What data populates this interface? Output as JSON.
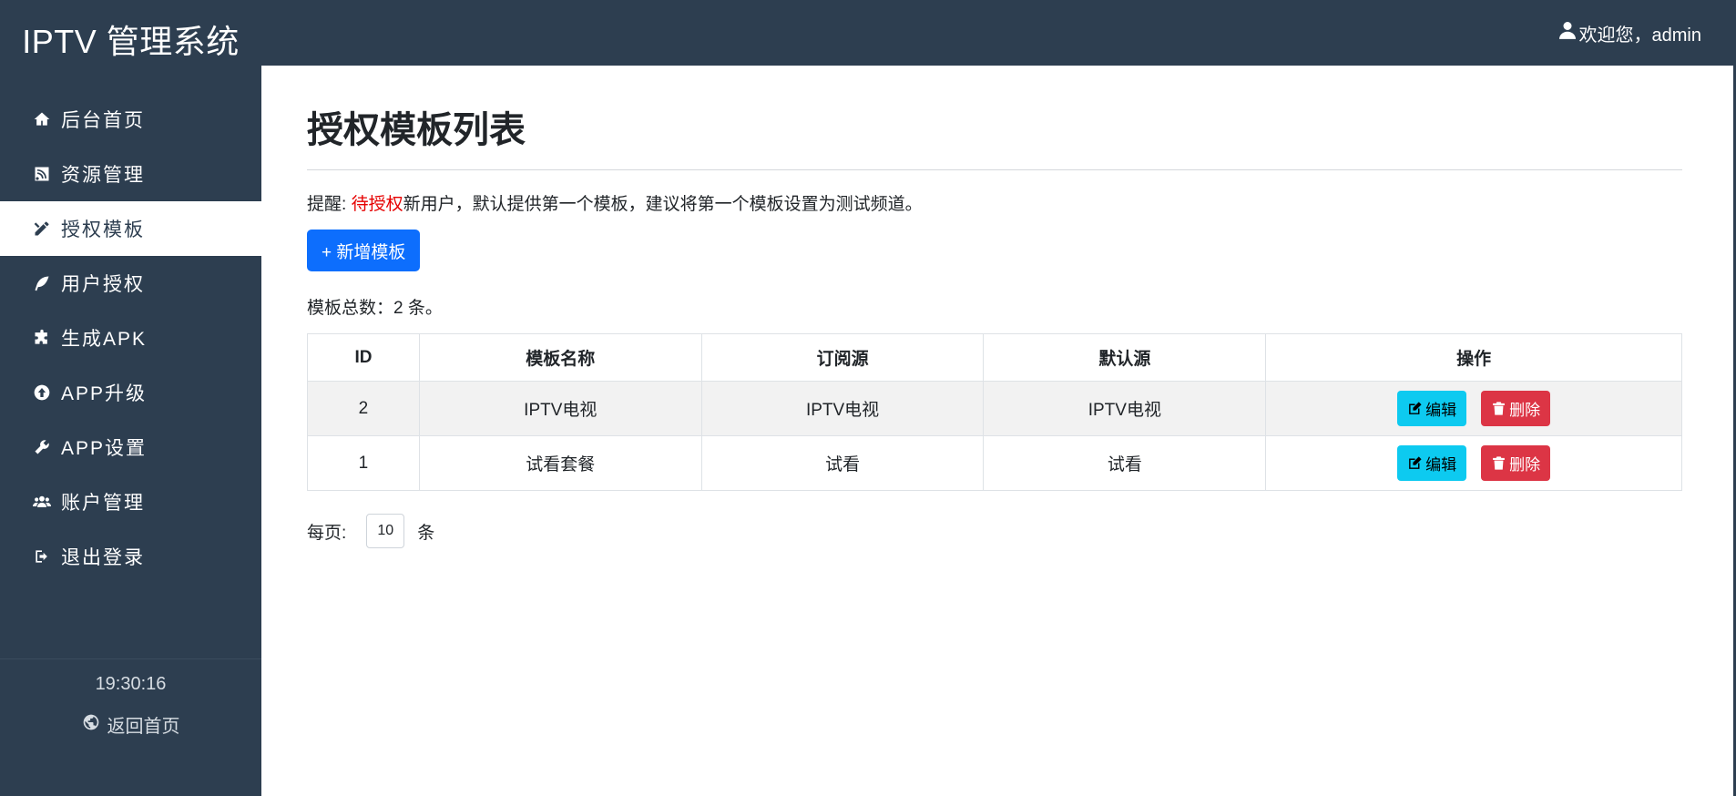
{
  "sidebar": {
    "brand": "IPTV 管理系统",
    "items": [
      {
        "label": "后台首页",
        "icon": "home-icon"
      },
      {
        "label": "资源管理",
        "icon": "rss-icon"
      },
      {
        "label": "授权模板",
        "icon": "tools-icon",
        "active": true
      },
      {
        "label": "用户授权",
        "icon": "feather-icon"
      },
      {
        "label": "生成APK",
        "icon": "puzzle-icon"
      },
      {
        "label": "APP升级",
        "icon": "upload-circle-icon"
      },
      {
        "label": "APP设置",
        "icon": "wrench-icon"
      },
      {
        "label": "账户管理",
        "icon": "users-icon"
      },
      {
        "label": "退出登录",
        "icon": "sign-out-icon"
      }
    ],
    "clock": "19:30:16",
    "back_home": "返回首页"
  },
  "header": {
    "user_greeting": "欢迎您，admin"
  },
  "main": {
    "title": "授权模板列表",
    "notice_prefix": "提醒: ",
    "notice_highlight": "待授权",
    "notice_suffix": "新用户，默认提供第一个模板，建议将第一个模板设置为测试频道。",
    "add_button": "+ 新增模板",
    "total_text": "模板总数：2 条。",
    "table": {
      "headers": [
        "ID",
        "模板名称",
        "订阅源",
        "默认源",
        "操作"
      ],
      "rows": [
        {
          "id": "2",
          "name": "IPTV电视",
          "subscribe": "IPTV电视",
          "default": "IPTV电视"
        },
        {
          "id": "1",
          "name": "试看套餐",
          "subscribe": "试看",
          "default": "试看"
        }
      ],
      "edit_label": "编辑",
      "delete_label": "删除"
    },
    "pager": {
      "label": "每页:",
      "page_size": "10",
      "unit": "条"
    }
  },
  "colors": {
    "sidebar_bg": "#2d3e50",
    "primary": "#0d6efd",
    "info": "#0dcaf0",
    "danger": "#dc3545",
    "highlight_text": "#e60000"
  }
}
